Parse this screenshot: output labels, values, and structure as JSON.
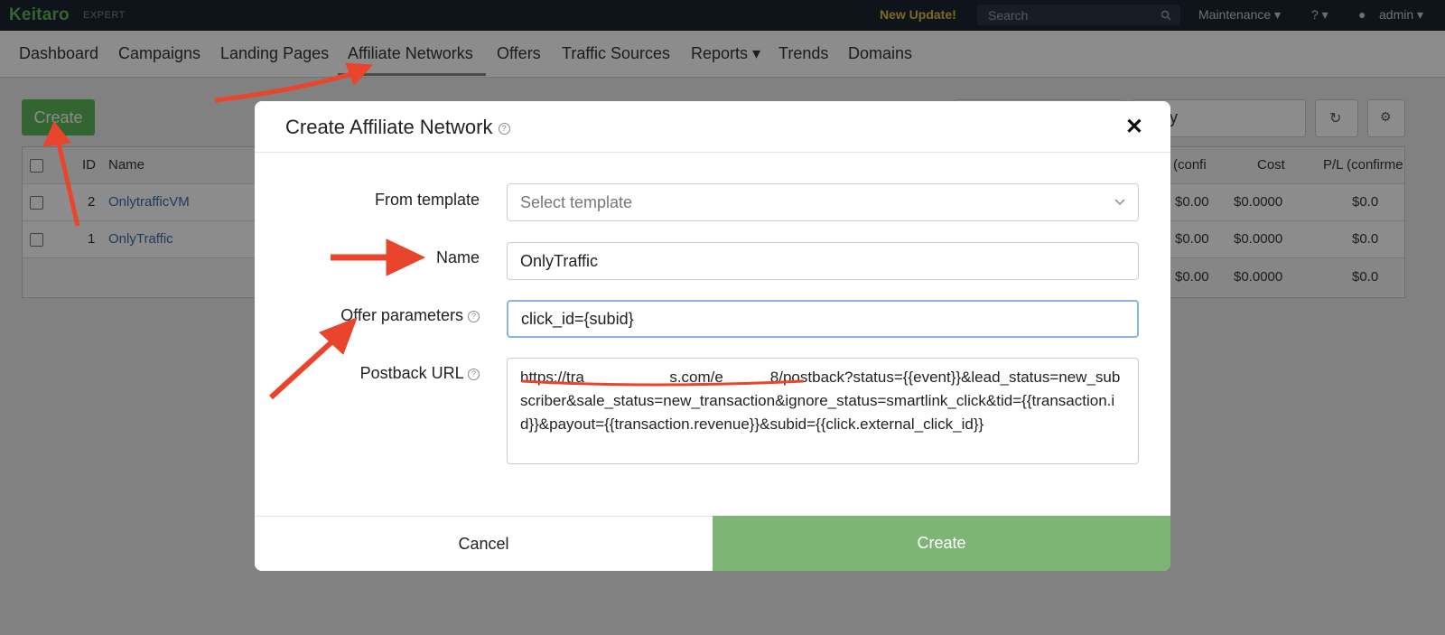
{
  "topbar": {
    "logo": "Keitaro",
    "edition": "EXPERT",
    "new_update": "New Update!",
    "search_placeholder": "Search",
    "maintenance": "Maintenance ▾",
    "help": "? ▾",
    "user": "admin ▾"
  },
  "nav": {
    "items": [
      "Dashboard",
      "Campaigns",
      "Landing Pages",
      "Affiliate Networks",
      "Offers",
      "Traffic Sources",
      "Reports ▾",
      "Trends",
      "Domains"
    ]
  },
  "page": {
    "create_label": "Create",
    "period_label": "ay",
    "table": {
      "headers": [
        "ID",
        "Name",
        "(confi",
        "Cost",
        "P/L (confirme"
      ],
      "rows": [
        {
          "id": "2",
          "name": "OnlytrafficVM",
          "confirmed": "$0.00",
          "cost": "$0.0000",
          "pl": "$0.0"
        },
        {
          "id": "1",
          "name": "OnlyTraffic",
          "confirmed": "$0.00",
          "cost": "$0.0000",
          "pl": "$0.0"
        }
      ],
      "totals": {
        "confirmed": "$0.00",
        "cost": "$0.0000",
        "pl": "$0.0"
      }
    }
  },
  "modal": {
    "title": "Create Affiliate Network",
    "from_template_label": "From template",
    "from_template_placeholder": "Select template",
    "name_label": "Name",
    "name_value": "OnlyTraffic",
    "offer_params_label": "Offer parameters",
    "offer_params_value": "click_id={subid}",
    "postback_label": "Postback URL",
    "postback_value": "https://tra                    s.com/e           8/postback?status={{event}}&lead_status=new_subscriber&sale_status=new_transaction&ignore_status=smartlink_click&tid={{transaction.id}}&payout={{transaction.revenue}}&subid={{click.external_click_id}}",
    "cancel_label": "Cancel",
    "create_label": "Create"
  },
  "colors": {
    "accent_green": "#5cb85c",
    "annotation_red": "#e8452c"
  }
}
